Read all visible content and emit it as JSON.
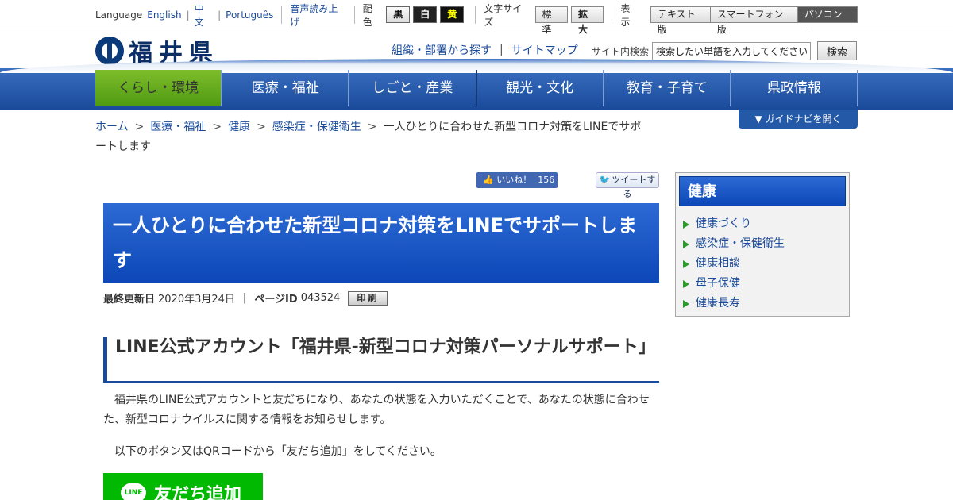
{
  "utility": {
    "language_label": "Language",
    "lang_en": "English",
    "lang_zh": "中文",
    "lang_pt": "Português",
    "read_aloud": "音声読み上げ",
    "color_label": "配色",
    "color_black": "黒",
    "color_white": "白",
    "color_yellow": "黄",
    "font_size_label": "文字サイズ",
    "font_standard": "標準",
    "font_large": "拡大",
    "display_label": "表示",
    "view_text": "テキスト版",
    "view_smartphone": "スマートフォン版",
    "view_pc": "パソコン版"
  },
  "header": {
    "logo_text": "福井県",
    "link_dept": "組織・部署から探す",
    "link_sitemap": "サイトマップ",
    "search_label": "サイト内検索",
    "search_placeholder": "検索したい単語を入力してください",
    "search_button": "検索"
  },
  "nav": {
    "items": [
      {
        "label": "くらし・環境"
      },
      {
        "label": "医療・福祉"
      },
      {
        "label": "しごと・産業"
      },
      {
        "label": "観光・文化"
      },
      {
        "label": "教育・子育て"
      },
      {
        "label": "県政情報"
      }
    ]
  },
  "breadcrumb": {
    "items": [
      "ホーム",
      "医療・福祉",
      "健康",
      "感染症・保健衛生"
    ],
    "current": "一人ひとりに合わせた新型コロナ対策をLINEでサポートします"
  },
  "guide_button": "ガイドナビを開く",
  "social": {
    "fb_label": "いいね！",
    "fb_count": "156",
    "tweet_label": "ツイートする"
  },
  "article": {
    "title": "一人ひとりに合わせた新型コロナ対策をLINEでサポートします",
    "updated_label": "最終更新日",
    "updated_value": "2020年3月24日",
    "page_id_label": "ページID",
    "page_id_value": "043524",
    "print_button": "印刷",
    "h2": "LINE公式アカウント「福井県-新型コロナ対策パーソナルサポート」",
    "p1": "福井県のLINE公式アカウントと友だちになり、あなたの状態を入力いただくことで、あなたの状態に合わせた、新型コロナウイルスに関する情報をお知らせします。",
    "p2": "以下のボタン又はQRコードから「友だち追加」をしてください。",
    "line_icon": "LINE",
    "line_button": "友だち追加"
  },
  "sidebar": {
    "heading": "健康",
    "items": [
      {
        "label": "健康づくり"
      },
      {
        "label": "感染症・保健衛生"
      },
      {
        "label": "健康相談"
      },
      {
        "label": "母子保健"
      },
      {
        "label": "健康長寿"
      }
    ]
  }
}
